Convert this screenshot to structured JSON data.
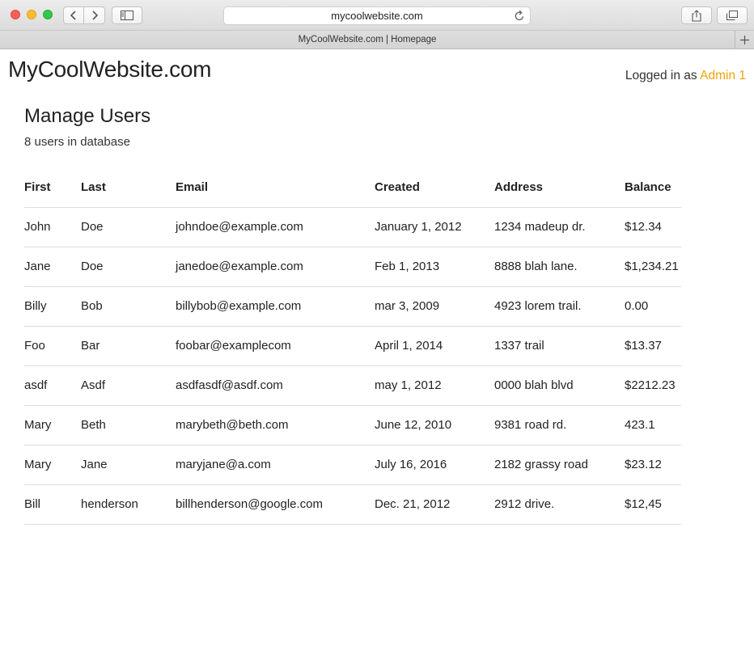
{
  "browser": {
    "url": "mycoolwebsite.com",
    "tab_title": "MyCoolWebsite.com | Homepage"
  },
  "header": {
    "logo": "MyCoolWebsite.com",
    "logged_in_prefix": "Logged in as",
    "username": "Admin 1"
  },
  "main": {
    "title": "Manage Users",
    "subtitle": "8 users in database"
  },
  "table": {
    "columns": [
      "First",
      "Last",
      "Email",
      "Created",
      "Address",
      "Balance"
    ],
    "rows": [
      [
        "John",
        "Doe",
        "johndoe@example.com",
        "January 1, 2012",
        "1234 madeup dr.",
        "$12.34"
      ],
      [
        "Jane",
        "Doe",
        "janedoe@example.com",
        "Feb 1, 2013",
        "8888 blah lane.",
        "$1,234.21"
      ],
      [
        "Billy",
        "Bob",
        "billybob@example.com",
        "mar 3, 2009",
        "4923 lorem trail.",
        "0.00"
      ],
      [
        "Foo",
        "Bar",
        "foobar@examplecom",
        "April 1, 2014",
        "1337 trail",
        "$13.37"
      ],
      [
        "asdf",
        "Asdf",
        "asdfasdf@asdf.com",
        "may 1, 2012",
        "0000 blah blvd",
        "$2212.23"
      ],
      [
        "Mary",
        "Beth",
        "marybeth@beth.com",
        "June 12, 2010",
        "9381 road rd.",
        "423.1"
      ],
      [
        "Mary",
        "Jane",
        "maryjane@a.com",
        "July 16, 2016",
        "2182 grassy road",
        "$23.12"
      ],
      [
        "Bill",
        "henderson",
        "billhenderson@google.com",
        "Dec. 21, 2012",
        "2912 drive.",
        "$12,45"
      ]
    ]
  },
  "colors": {
    "accent": "#f0a30a",
    "row_border": "#dcdcdc"
  }
}
